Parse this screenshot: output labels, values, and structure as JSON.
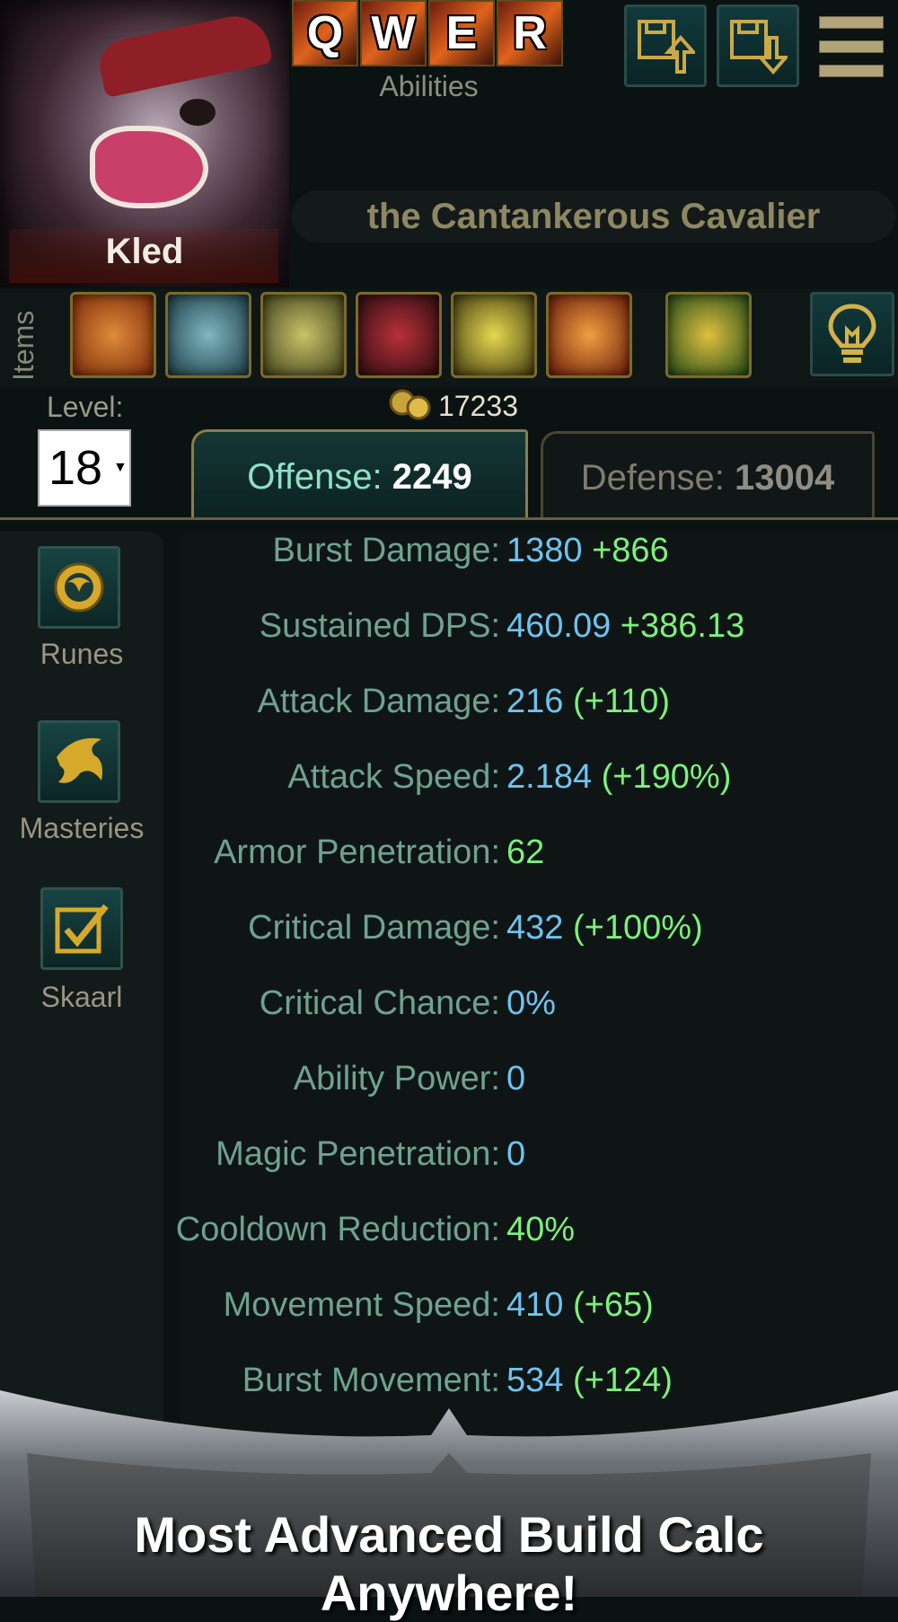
{
  "champion": {
    "name": "Kled",
    "title": "the Cantankerous Cavalier"
  },
  "abilities": {
    "keys": [
      "Q",
      "W",
      "E",
      "R"
    ],
    "label": "Abilities"
  },
  "toolbar": {
    "save_icon": "floppy-upload-icon",
    "load_icon": "floppy-download-icon",
    "menu_icon": "hamburger-menu-icon"
  },
  "items": {
    "label": "Items",
    "slots": [
      {
        "icon": "item-1-icon",
        "color": "#c0581c"
      },
      {
        "icon": "item-2-icon",
        "color": "#3e6f7a"
      },
      {
        "icon": "item-3-icon",
        "color": "#8a8a2a"
      },
      {
        "icon": "item-4-icon",
        "color": "#7a1a1f"
      },
      {
        "icon": "item-5-icon",
        "color": "#9a8a25"
      },
      {
        "icon": "item-6-icon",
        "color": "#b8401a"
      },
      {
        "icon": "trinket-icon",
        "color": "#3a7a20"
      }
    ],
    "gold": "17233"
  },
  "level": {
    "label": "Level:",
    "value": "18"
  },
  "tabs": {
    "offense_label": "Offense:",
    "offense_value": "2249",
    "defense_label": "Defense:",
    "defense_value": "13004"
  },
  "sidebar": {
    "runes": "Runes",
    "masteries": "Masteries",
    "skaarl": "Skaarl"
  },
  "stats": [
    {
      "label": "Burst Damage:",
      "base": "1380",
      "bonus": "+866",
      "base_color": "blue"
    },
    {
      "label": "Sustained DPS:",
      "base": "460.09",
      "bonus": "+386.13",
      "base_color": "blue"
    },
    {
      "label": "Attack Damage:",
      "base": "216",
      "bonus": "(+110)",
      "base_color": "blue"
    },
    {
      "label": "Attack Speed:",
      "base": "2.184",
      "bonus": "(+190%)",
      "base_color": "blue"
    },
    {
      "label": "Armor Penetration:",
      "base": "62",
      "bonus": "",
      "base_color": "green"
    },
    {
      "label": "Critical Damage:",
      "base": "432",
      "bonus": "(+100%)",
      "base_color": "blue"
    },
    {
      "label": "Critical Chance:",
      "base": "0%",
      "bonus": "",
      "base_color": "blue"
    },
    {
      "label": "Ability Power:",
      "base": "0",
      "bonus": "",
      "base_color": "blue"
    },
    {
      "label": "Magic Penetration:",
      "base": "0",
      "bonus": "",
      "base_color": "blue"
    },
    {
      "label": "Cooldown Reduction:",
      "base": "40%",
      "bonus": "",
      "base_color": "green"
    },
    {
      "label": "Movement Speed:",
      "base": "410",
      "bonus": "(+65)",
      "base_color": "blue"
    },
    {
      "label": "Burst Movement:",
      "base": "534",
      "bonus": "(+124)",
      "base_color": "blue"
    }
  ],
  "banner": {
    "text": "Most Advanced Build Calc Anywhere!"
  }
}
